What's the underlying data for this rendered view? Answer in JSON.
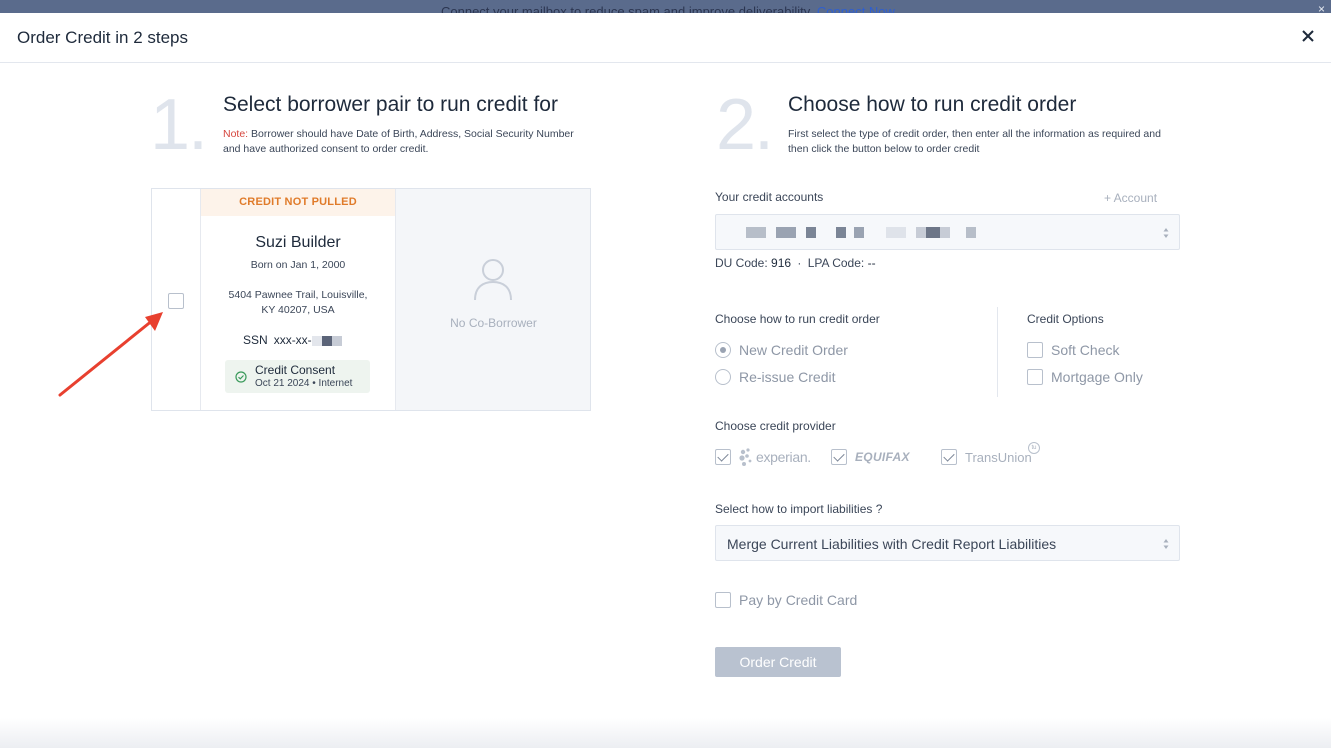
{
  "banner": {
    "text": "Connect your mailbox to reduce spam and improve deliverability.",
    "link": "Connect Now",
    "close": "×"
  },
  "modal": {
    "title": "Order Credit in 2 steps"
  },
  "step1": {
    "number": "1.",
    "title": "Select borrower pair to run credit for",
    "note_label": "Note:",
    "note_text": "Borrower should have Date of Birth, Address, Social Security Number and have authorized consent to order credit.",
    "card": {
      "status": "CREDIT NOT PULLED",
      "name": "Suzi Builder",
      "born": "Born on Jan 1, 2000",
      "address": "5404 Pawnee Trail, Louisville, KY 40207, USA",
      "ssn_label": "SSN",
      "ssn_value": "xxx-xx-",
      "consent_title": "Credit Consent",
      "consent_sub": "Oct 21 2024 • Internet",
      "co_borrower": "No Co-Borrower"
    }
  },
  "step2": {
    "number": "2.",
    "title": "Choose how to run credit order",
    "desc": "First select the type of credit order, then enter all the information as required and then click the button below to order credit",
    "accounts_label": "Your credit accounts",
    "add_account": "+ Account",
    "du_label": "DU Code:",
    "du_value": "916",
    "separator": "·",
    "lpa_label": "LPA Code:",
    "lpa_value": "--",
    "run_label": "Choose how to run credit order",
    "run_options": [
      "New Credit Order",
      "Re-issue Credit"
    ],
    "run_selected": "New Credit Order",
    "options_label": "Credit Options",
    "credit_options": [
      "Soft Check",
      "Mortgage Only"
    ],
    "provider_label": "Choose credit provider",
    "providers": [
      "experian.",
      "EQUIFAX",
      "TransUnion"
    ],
    "liabilities_label": "Select how to import liabilities ?",
    "liabilities_value": "Merge Current Liabilities with Credit Report Liabilities",
    "pay_card": "Pay by Credit Card",
    "order_button": "Order Credit"
  },
  "colors": {
    "accent_orange": "#e07b2a",
    "note_red": "#d6453d",
    "arrow_red": "#e8402f",
    "button_disabled": "#b9c2d0"
  },
  "icons": [
    "close-icon",
    "person-icon",
    "check-circle-icon",
    "select-arrows-icon",
    "annotation-arrow"
  ]
}
